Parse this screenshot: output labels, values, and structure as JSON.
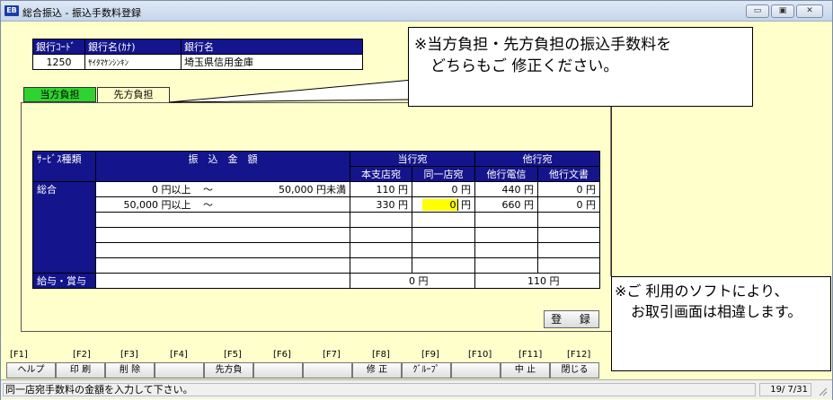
{
  "window": {
    "icon_text": "EB",
    "title": "総合振込 - 振込手数料登録",
    "controls": [
      "▭",
      "▣",
      "✕"
    ]
  },
  "bank": {
    "headers": [
      "銀行ｺｰﾄﾞ",
      "銀行名(ｶﾅ)",
      "銀行名"
    ],
    "code": "1250",
    "kana": "ｻｲﾀﾏｹﾝｼﾝｷﾝ",
    "name": "埼玉県信用金庫"
  },
  "tabs": [
    "当方負担",
    "先方負担"
  ],
  "fee_table": {
    "col_service": "ｻｰﾋﾞｽ種類",
    "col_amount": "振　込　金　額",
    "group_same_bank": "当行宛",
    "group_other_bank": "他行宛",
    "sub_main": "本支店宛",
    "sub_same": "同一店宛",
    "sub_tel": "他行電信",
    "sub_doc": "他行文書",
    "category_general": "総合",
    "category_salary": "給与・賞与",
    "rows": [
      {
        "from": "0 円以上",
        "tilde": "～",
        "to": "50,000 円未満",
        "main": "110 円",
        "same": "0 円",
        "tel": "440 円",
        "doc": "0 円"
      },
      {
        "from": "50,000 円以上",
        "tilde": "～",
        "to": "",
        "main": "330 円",
        "same": "0",
        "same_unit": "円",
        "tel": "660 円",
        "doc": "0 円"
      }
    ],
    "salary_same": "0 円",
    "salary_other": "110 円"
  },
  "register_button": "登 録",
  "function_keys": {
    "labels": [
      "[F1]",
      "[F2]",
      "[F3]",
      "[F4]",
      "[F5]",
      "[F6]",
      "[F7]",
      "[F8]",
      "[F9]",
      "[F10]",
      "[F11]",
      "[F12]"
    ],
    "buttons": [
      "ヘルプ",
      "印 刷",
      "削 除",
      "",
      "先方負",
      "",
      "",
      "修 正",
      "ｸﾞﾙｰﾌﾟ",
      "",
      "中 止",
      "閉じる"
    ]
  },
  "status": {
    "message": "同一店宛手数料の金額を入力して下さい。",
    "date": "19/ 7/31"
  },
  "callouts": {
    "top_line1": "※当方負担・先方負担の振込手数料を",
    "top_line2": "どちらもご 修正ください。",
    "bottom_line1": "※ご 利用のソフトにより、",
    "bottom_line2": "お取引画面は相違します。"
  }
}
